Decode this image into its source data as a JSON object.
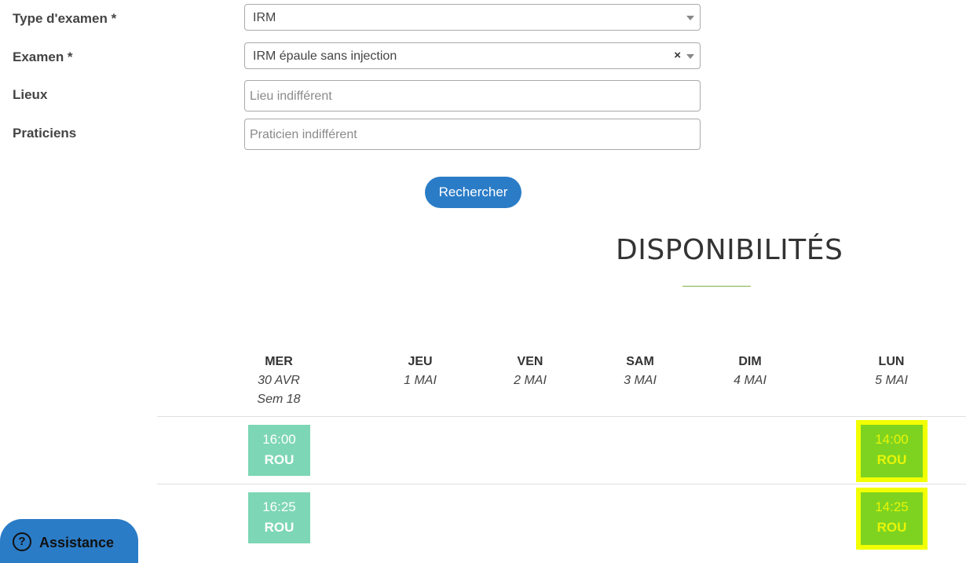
{
  "form": {
    "type_label": "Type d'examen *",
    "type_value": "IRM",
    "exam_label": "Examen *",
    "exam_value": "IRM épaule sans injection",
    "exam_clear": "×",
    "lieux_label": "Lieux",
    "lieux_placeholder": "Lieu indifférent",
    "praticiens_label": "Praticiens",
    "praticiens_placeholder": "Praticien indifférent",
    "search_button": "Rechercher"
  },
  "availability": {
    "title": "DISPONIBILITÉS",
    "days": [
      {
        "name": "MER",
        "date": "30 AVR",
        "week": "Sem 18"
      },
      {
        "name": "JEU",
        "date": "1 MAI",
        "week": ""
      },
      {
        "name": "VEN",
        "date": "2 MAI",
        "week": ""
      },
      {
        "name": "SAM",
        "date": "3 MAI",
        "week": ""
      },
      {
        "name": "DIM",
        "date": "4 MAI",
        "week": ""
      },
      {
        "name": "LUN",
        "date": "5 MAI",
        "week": ""
      }
    ],
    "slots": [
      {
        "time": "16:00",
        "code": "ROU"
      },
      {
        "time": "14:00",
        "code": "ROU"
      },
      {
        "time": "16:25",
        "code": "ROU"
      },
      {
        "time": "14:25",
        "code": "ROU"
      }
    ]
  },
  "assistance": {
    "icon": "question-circle-icon",
    "label": "Assistance",
    "icon_glyph": "?"
  },
  "colors": {
    "primary": "#2b7cc7",
    "slot": "#7dd6b6",
    "slot_highlight": "#7ed321",
    "highlight_outline": "#f2ff00"
  }
}
